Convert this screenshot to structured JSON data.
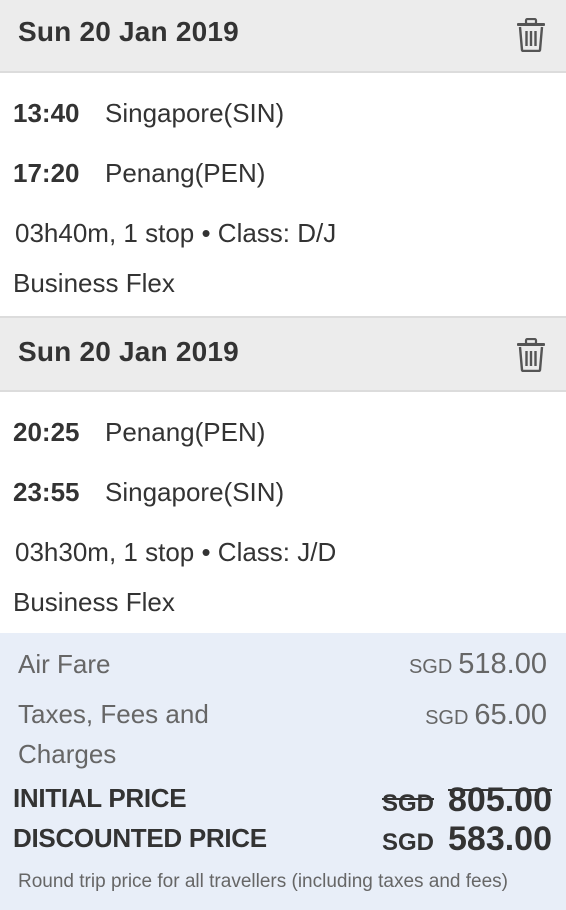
{
  "segments": [
    {
      "date": "Sun 20 Jan 2019",
      "departure_time": "13:40",
      "departure_airport": "Singapore(SIN)",
      "arrival_time": "17:20",
      "arrival_airport": "Penang(PEN)",
      "duration_stops": "03h40m, 1 stop",
      "class_text": "• Class: D/J",
      "fare_type": "Business Flex",
      "delete_icon": "trash-icon"
    },
    {
      "date": "Sun 20 Jan 2019",
      "departure_time": "20:25",
      "departure_airport": "Penang(PEN)",
      "arrival_time": "23:55",
      "arrival_airport": "Singapore(SIN)",
      "duration_stops": "03h30m, 1 stop",
      "class_text": "• Class: J/D",
      "fare_type": "Business Flex",
      "delete_icon": "trash-icon"
    }
  ],
  "fare": {
    "air_fare_label": "Air Fare",
    "air_fare_currency": "SGD",
    "air_fare_amount": "518.00",
    "taxes_label_line1": "Taxes, Fees and",
    "taxes_label_line2": "Charges",
    "taxes_currency": "SGD",
    "taxes_amount": "65.00",
    "initial_label": "INITIAL PRICE",
    "initial_currency": "SGD",
    "initial_amount": "805.00",
    "discounted_label": "DISCOUNTED PRICE",
    "discounted_currency": "SGD",
    "discounted_amount": "583.00",
    "footnote": "Round trip price for all travellers (including taxes and fees)"
  },
  "colors": {
    "header_bg": "#ececec",
    "fare_panel_bg": "#e8eef8",
    "text_primary": "#333333",
    "text_secondary": "#666666"
  }
}
